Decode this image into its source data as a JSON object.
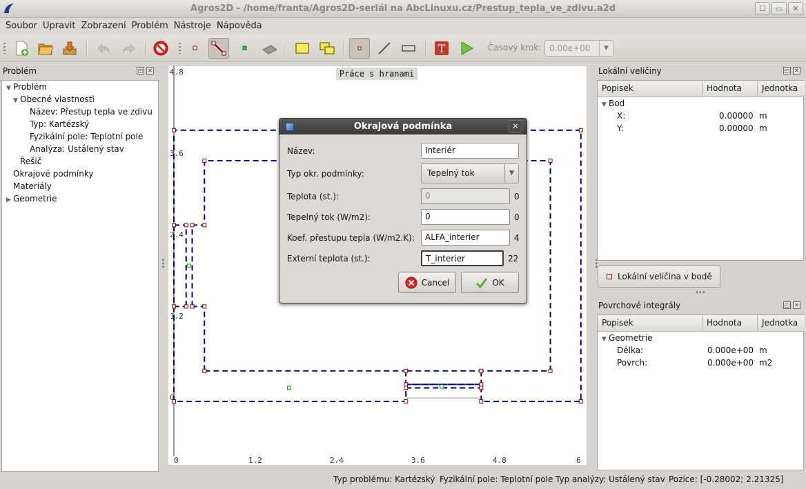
{
  "window": {
    "title": "Agros2D - /home/franta/Agros2D-seriál na AbcLinuxu.cz/Prestup_tepla_ve_zdivu.a2d",
    "buttons": [
      "☐",
      "▭",
      "✕"
    ]
  },
  "menu": [
    "Soubor",
    "Upravit",
    "Zobrazení",
    "Problém",
    "Nástroje",
    "Nápověda"
  ],
  "toolbar": {
    "timestep_label": "Časový krok:",
    "timestep_value": "0.00e+00"
  },
  "left_panel": {
    "title": "Problém",
    "tree": [
      {
        "label": "Problém",
        "level": 0,
        "expander": "▼"
      },
      {
        "label": "Obecné vlastnosti",
        "level": 1,
        "expander": "▼"
      },
      {
        "label": "Název: Přestup tepla ve zdivu",
        "level": 2,
        "expander": ""
      },
      {
        "label": "Typ: Kartézský",
        "level": 2,
        "expander": ""
      },
      {
        "label": "Fyzikální pole: Teplotní pole",
        "level": 2,
        "expander": ""
      },
      {
        "label": "Analýza: Ustálený stav",
        "level": 2,
        "expander": ""
      },
      {
        "label": "Řešič",
        "level": 1,
        "expander": ""
      },
      {
        "label": "Okrajové podmínky",
        "level": 0,
        "expander": ""
      },
      {
        "label": "Materiály",
        "level": 0,
        "expander": ""
      },
      {
        "label": "Geometrie",
        "level": 0,
        "expander": "▶"
      }
    ]
  },
  "canvas": {
    "mode_label": "Práce s hranami",
    "y_ticks": [
      "4.8",
      "3.6",
      "2.4",
      "1.2",
      "0"
    ],
    "x_ticks": [
      "0",
      "1.2",
      "2.4",
      "3.6",
      "4.8",
      "6"
    ]
  },
  "local_values": {
    "title": "Lokální veličiny",
    "headers": [
      "Popisek",
      "Hodnota",
      "Jednotka"
    ],
    "group": "Bod",
    "rows": [
      {
        "label": "X:",
        "value": "0.00000",
        "unit": "m"
      },
      {
        "label": "Y:",
        "value": "0.00000",
        "unit": "m"
      }
    ],
    "button": "Lokální veličina v bodě"
  },
  "surface_integrals": {
    "title": "Povrchové integrály",
    "headers": [
      "Popisek",
      "Hodnota",
      "Jednotka"
    ],
    "group": "Geometrie",
    "rows": [
      {
        "label": "Délka:",
        "value": "0.000e+00",
        "unit": "m"
      },
      {
        "label": "Povrch:",
        "value": "0.000e+00",
        "unit": "m2"
      }
    ]
  },
  "dialog": {
    "title": "Okrajová podmínka",
    "close": "✕",
    "fields": {
      "name_label": "Název:",
      "name_value": "Interiér",
      "type_label": "Typ okr. podmínky:",
      "type_value": "Tepelný tok",
      "temp_label": "Teplota (st.):",
      "temp_value": "0",
      "temp_result": "0",
      "flux_label": "Tepelný tok (W/m2):",
      "flux_value": "0",
      "flux_result": "0",
      "coef_label": "Koef. přestupu tepla (W/m2.K):",
      "coef_value": "ALFA_interier",
      "coef_result": "4",
      "ext_label": "Externí teplota (st.):",
      "ext_value": "T_interier",
      "ext_result": "22"
    },
    "cancel_label": "Cancel",
    "ok_label": "OK"
  },
  "status": {
    "problem_type": "Typ problému: Kartézský",
    "field": "Fyzikální pole: Teplotní pole",
    "analysis": "Typ analýzy: Ustálený stav",
    "position": "Pozice: [-0.28002;  2.21325]"
  },
  "colors": {
    "edge": "#000080",
    "node": "#8b0000",
    "label_marker": "#00a000"
  }
}
